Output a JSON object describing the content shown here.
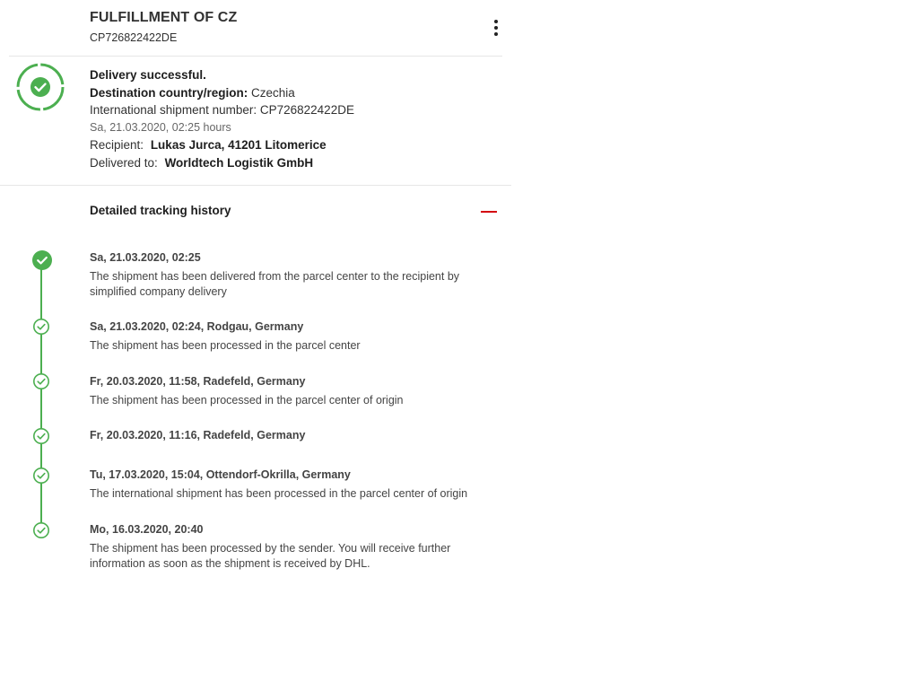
{
  "header": {
    "title": "FULFILLMENT OF CZ",
    "tracking_number": "CP726822422DE"
  },
  "summary": {
    "status": "Delivery successful.",
    "destination_label": "Destination country/region:",
    "destination_value": "Czechia",
    "intl_label": "International shipment number:",
    "intl_value": "CP726822422DE",
    "timestamp": "Sa, 21.03.2020, 02:25 hours",
    "recipient_label": "Recipient:",
    "recipient_value": "Lukas Jurca, 41201 Litomerice",
    "delivered_to_label": "Delivered to:",
    "delivered_to_value": "Worldtech Logistik GmbH"
  },
  "history": {
    "title": "Detailed tracking history",
    "events": [
      {
        "date": "Sa, 21.03.2020, 02:25",
        "description": "The shipment has been delivered from the parcel center to the recipient by simplified company delivery"
      },
      {
        "date": "Sa, 21.03.2020, 02:24, Rodgau, Germany",
        "description": "The shipment has been processed in the parcel center"
      },
      {
        "date": "Fr, 20.03.2020, 11:58, Radefeld, Germany",
        "description": "The shipment has been processed in the parcel center of origin"
      },
      {
        "date": "Fr, 20.03.2020, 11:16, Radefeld, Germany",
        "description": ""
      },
      {
        "date": "Tu, 17.03.2020, 15:04, Ottendorf-Okrilla, Germany",
        "description": "The international shipment has been processed in the parcel center of origin"
      },
      {
        "date": "Mo, 16.03.2020, 20:40",
        "description": "The shipment has been processed by the sender. You will receive further information as soon as the shipment is received by DHL."
      }
    ]
  },
  "icons": {
    "menu": "more-vertical-icon",
    "status": "delivered-check-icon",
    "collapse": "minus-icon",
    "event": "check-circle-icon"
  },
  "colors": {
    "success_green": "#4caf50",
    "accent_red": "#d40511"
  }
}
